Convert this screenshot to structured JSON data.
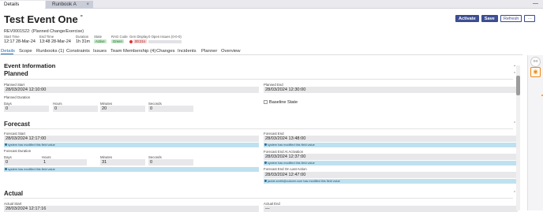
{
  "window_tabs": [
    {
      "label": "Details",
      "closable": false
    },
    {
      "label": "Runbook A",
      "closable": true,
      "close_glyph": "×"
    }
  ],
  "window_menu_glyph": "—",
  "header": {
    "title": "Test Event One",
    "link_glyph": "⚭",
    "reference": "REV0001522: (Planned Change/Exercise)",
    "actions": {
      "activate": "Activate",
      "save": "Save",
      "refresh": "Refresh",
      "more": "···"
    }
  },
  "meta": {
    "start_time": {
      "label": "Start Time",
      "value": "12:17 28-Mar-24"
    },
    "end_time": {
      "label": "End Time",
      "value": "13:48 28-Mar-24"
    },
    "duration": {
      "label": "Duration",
      "value": "1h 31m"
    },
    "state": {
      "label": "State",
      "value": "Active"
    },
    "rag_code": {
      "label": "RAG Code",
      "value": "Green"
    },
    "gen_display": {
      "label": "Gen Display",
      "value": "00:21s"
    },
    "open_issues": {
      "label": "0 Open Issues (0-0-0)"
    }
  },
  "nav_tabs": [
    "Details",
    "Scope",
    "Runbooks (1)",
    "Constraints",
    "Issues",
    "Team Membership (4)",
    "Changes",
    "Incidents",
    "Planner",
    "Overview"
  ],
  "event_information": {
    "title": "Event Information",
    "caret": "⌄"
  },
  "planned": {
    "title": "Planned",
    "caret": "⌃",
    "planned_start": {
      "label": "Planned Start",
      "value": "28/03/2024 12:10:00"
    },
    "planned_end": {
      "label": "Planned End",
      "value": "28/03/2024 12:30:00"
    },
    "duration_label": "Planned Duration",
    "days": {
      "label": "Days",
      "value": "0"
    },
    "hours": {
      "label": "Hours",
      "value": "0"
    },
    "minutes": {
      "label": "Minutes",
      "value": "20"
    },
    "seconds": {
      "label": "Seconds",
      "value": "0"
    },
    "baseline": "Baseline State"
  },
  "forecast": {
    "title": "Forecast",
    "caret": "⌃",
    "forecast_start": {
      "label": "Forecast Start",
      "value": "28/03/2024 12:17:00",
      "note": "system has modified this field value"
    },
    "duration_label": "Forecast Duration",
    "days": {
      "label": "Days",
      "value": "0"
    },
    "hours": {
      "label": "Hours",
      "value": "1"
    },
    "minutes": {
      "label": "Minutes",
      "value": "31"
    },
    "seconds": {
      "label": "Seconds",
      "value": "0"
    },
    "duration_note": "system has modified this field value",
    "forecast_end": {
      "label": "Forecast End",
      "value": "28/03/2024 13:48:00",
      "note": "system has modified this field value"
    },
    "end_at_activation": {
      "label": "Forecast End At Activation",
      "value": "28/03/2024 12:37:00",
      "note": "system has modified this field value"
    },
    "end_on_last_action": {
      "label": "Forecast End On Last Action",
      "value": "28/03/2024 12:47:00",
      "note": "jackie.smith@cutover.com has modified this field value"
    }
  },
  "actual": {
    "title": "Actual",
    "caret": "⌃",
    "actual_start": {
      "label": "Actual Start",
      "value": "28/03/2024 12:17:16"
    },
    "actual_end": {
      "label": "Actual End",
      "value": "—"
    }
  },
  "side_rail": {
    "link_icon": "⚯",
    "eye_icon": "◉"
  }
}
